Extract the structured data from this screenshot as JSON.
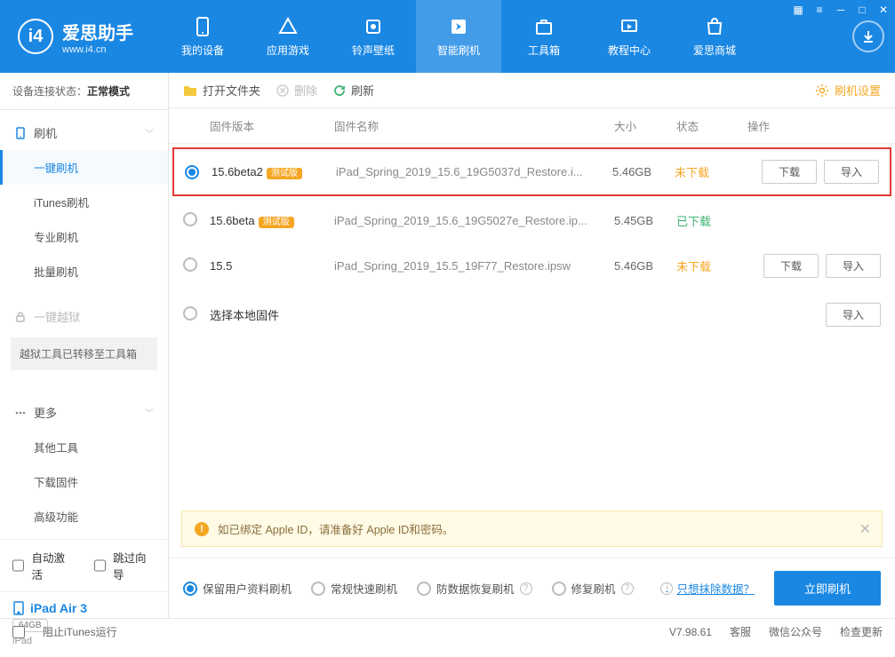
{
  "app": {
    "name": "爱思助手",
    "domain": "www.i4.cn"
  },
  "nav": {
    "tabs": [
      {
        "label": "我的设备",
        "icon": "device"
      },
      {
        "label": "应用游戏",
        "icon": "apps"
      },
      {
        "label": "铃声壁纸",
        "icon": "ringtone"
      },
      {
        "label": "智能刷机",
        "icon": "flash",
        "active": true
      },
      {
        "label": "工具箱",
        "icon": "toolbox"
      },
      {
        "label": "教程中心",
        "icon": "tutorial"
      },
      {
        "label": "爱思商城",
        "icon": "store"
      }
    ]
  },
  "connection": {
    "label": "设备连接状态：",
    "value": "正常模式"
  },
  "sidebar": {
    "flash": {
      "heading": "刷机",
      "items": [
        "一键刷机",
        "iTunes刷机",
        "专业刷机",
        "批量刷机"
      ],
      "activeIdx": 0
    },
    "jailbreak": {
      "heading": "一键越狱",
      "note": "越狱工具已转移至工具箱"
    },
    "more": {
      "heading": "更多",
      "items": [
        "其他工具",
        "下载固件",
        "高级功能"
      ]
    },
    "autoActivate": "自动激活",
    "skipGuide": "跳过向导",
    "device": {
      "name": "iPad Air 3",
      "storage": "64GB",
      "type": "iPad"
    }
  },
  "toolbar": {
    "open": "打开文件夹",
    "delete": "删除",
    "refresh": "刷新",
    "settings": "刷机设置"
  },
  "table": {
    "headers": {
      "version": "固件版本",
      "name": "固件名称",
      "size": "大小",
      "status": "状态",
      "ops": "操作"
    },
    "rows": [
      {
        "selected": true,
        "version": "15.6beta2",
        "beta": "测试版",
        "name": "iPad_Spring_2019_15.6_19G5037d_Restore.i...",
        "size": "5.46GB",
        "status": "未下载",
        "statusClass": "nd",
        "download": "下载",
        "import": "导入",
        "highlight": true
      },
      {
        "selected": false,
        "version": "15.6beta",
        "beta": "测试版",
        "name": "iPad_Spring_2019_15.6_19G5027e_Restore.ip...",
        "size": "5.45GB",
        "status": "已下载",
        "statusClass": "dl"
      },
      {
        "selected": false,
        "version": "15.5",
        "beta": "",
        "name": "iPad_Spring_2019_15.5_19F77_Restore.ipsw",
        "size": "5.46GB",
        "status": "未下载",
        "statusClass": "nd",
        "download": "下载",
        "import": "导入"
      },
      {
        "selected": false,
        "version": "选择本地固件",
        "local": true,
        "import": "导入"
      }
    ]
  },
  "alert": "如已绑定 Apple ID，请准备好 Apple ID和密码。",
  "flashOptions": {
    "items": [
      "保留用户资料刷机",
      "常规快速刷机",
      "防数据恢复刷机",
      "修复刷机"
    ],
    "selectedIdx": 0,
    "eraseLink": "只想抹除数据？",
    "action": "立即刷机"
  },
  "footer": {
    "blockItunes": "阻止iTunes运行",
    "version": "V7.98.61",
    "links": [
      "客服",
      "微信公众号",
      "检查更新"
    ]
  }
}
